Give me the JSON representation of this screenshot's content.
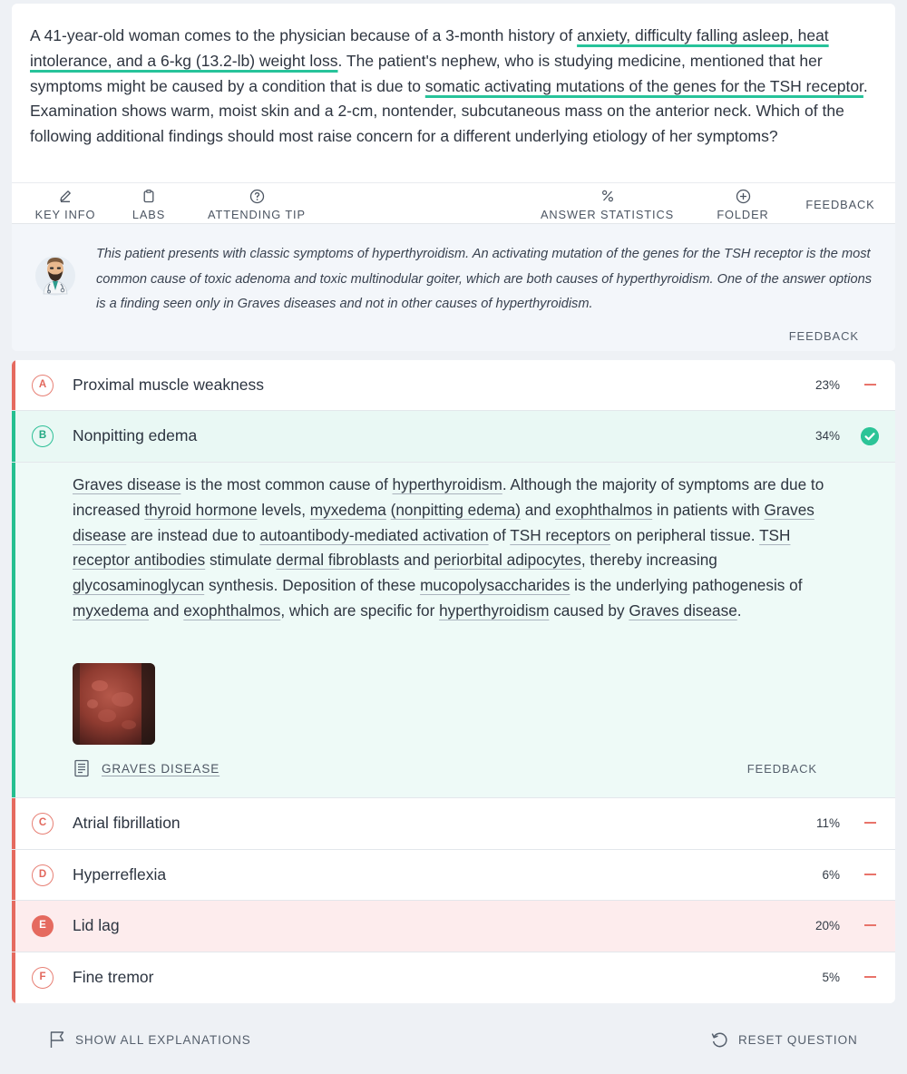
{
  "question": {
    "stem": [
      {
        "text": "A 41-year-old woman comes to the physician because of a 3-month history of ",
        "hl": false
      },
      {
        "text": "anxiety, difficulty falling asleep, heat intolerance, and a 6-kg (13.2-lb) weight loss",
        "hl": true
      },
      {
        "text": ". The patient's nephew, who is studying medicine, mentioned that her symptoms might be caused by a condition that is due to ",
        "hl": false
      },
      {
        "text": "somatic activating mutations of the genes for the TSH receptor",
        "hl": true
      },
      {
        "text": ". Examination shows warm, moist skin and a 2-cm, nontender, subcutaneous mass on the anterior neck. Which of the following additional findings should most raise concern for a different underlying etiology of her symptoms?",
        "hl": false
      }
    ]
  },
  "tabs": {
    "key_info": {
      "label": "KEY INFO",
      "icon": "pencil-icon"
    },
    "labs": {
      "label": "LABS",
      "icon": "clipboard-icon"
    },
    "attending_tip": {
      "label": "ATTENDING TIP",
      "icon": "question-circle-icon"
    },
    "answer_statistics": {
      "label": "ANSWER STATISTICS",
      "icon": "percent-icon"
    },
    "folder": {
      "label": "FOLDER",
      "icon": "plus-circle-icon"
    },
    "feedback": {
      "label": "FEEDBACK"
    }
  },
  "tip": {
    "text": "This patient presents with classic symptoms of hyperthyroidism. An activating mutation of the genes for the TSH receptor is the most common cause of toxic adenoma and toxic multinodular goiter, which are both causes of hyperthyroidism. One of the answer options is a finding seen only in Graves diseases and not in other causes of hyperthyroidism.",
    "feedback_label": "FEEDBACK"
  },
  "options": [
    {
      "letter": "A",
      "text": "Proximal muscle weakness",
      "percent": "23%"
    },
    {
      "letter": "B",
      "text": "Nonpitting edema",
      "percent": "34%"
    },
    {
      "letter": "C",
      "text": "Atrial fibrillation",
      "percent": "11%"
    },
    {
      "letter": "D",
      "text": "Hyperreflexia",
      "percent": "6%"
    },
    {
      "letter": "E",
      "text": "Lid lag",
      "percent": "20%"
    },
    {
      "letter": "F",
      "text": "Fine tremor",
      "percent": "5%"
    }
  ],
  "explanation": {
    "segments": [
      {
        "text": "Graves disease",
        "link": true
      },
      {
        "text": " is the most common cause of ",
        "link": false
      },
      {
        "text": "hyperthyroidism",
        "link": true
      },
      {
        "text": ". Although the majority of symptoms are due to increased ",
        "link": false
      },
      {
        "text": "thyroid hormone",
        "link": true
      },
      {
        "text": " levels, ",
        "link": false
      },
      {
        "text": "myxedema",
        "link": true
      },
      {
        "text": " ",
        "link": false
      },
      {
        "text": "(nonpitting edema)",
        "link": true
      },
      {
        "text": " and ",
        "link": false
      },
      {
        "text": "exophthalmos",
        "link": true
      },
      {
        "text": " in patients with ",
        "link": false
      },
      {
        "text": "Graves disease",
        "link": true
      },
      {
        "text": " are instead due to ",
        "link": false
      },
      {
        "text": "autoantibody-mediated activation",
        "link": true
      },
      {
        "text": " of ",
        "link": false
      },
      {
        "text": "TSH receptors",
        "link": true
      },
      {
        "text": " on peripheral tissue. ",
        "link": false
      },
      {
        "text": "TSH receptor antibodies",
        "link": true
      },
      {
        "text": " stimulate ",
        "link": false
      },
      {
        "text": "dermal fibroblasts",
        "link": true
      },
      {
        "text": " and ",
        "link": false
      },
      {
        "text": "periorbital adipocytes",
        "link": true
      },
      {
        "text": ", thereby increasing ",
        "link": false
      },
      {
        "text": "glycosaminoglycan",
        "link": true
      },
      {
        "text": " synthesis. Deposition of these ",
        "link": false
      },
      {
        "text": "mucopolysaccharides",
        "link": true
      },
      {
        "text": " is the underlying pathogenesis of ",
        "link": false
      },
      {
        "text": "myxedema",
        "link": true
      },
      {
        "text": " and ",
        "link": false
      },
      {
        "text": "exophthalmos",
        "link": true
      },
      {
        "text": ", which are specific for ",
        "link": false
      },
      {
        "text": "hyperthyroidism",
        "link": true
      },
      {
        "text": " caused by ",
        "link": false
      },
      {
        "text": "Graves disease",
        "link": true
      },
      {
        "text": ".",
        "link": false
      }
    ],
    "article_label": "GRAVES DISEASE",
    "feedback_label": "FEEDBACK"
  },
  "footer": {
    "show_all": "SHOW ALL EXPLANATIONS",
    "reset": "RESET QUESTION"
  },
  "colors": {
    "correct": "#25bf90",
    "incorrect": "#e56a5f",
    "highlight": "#27c39a"
  }
}
